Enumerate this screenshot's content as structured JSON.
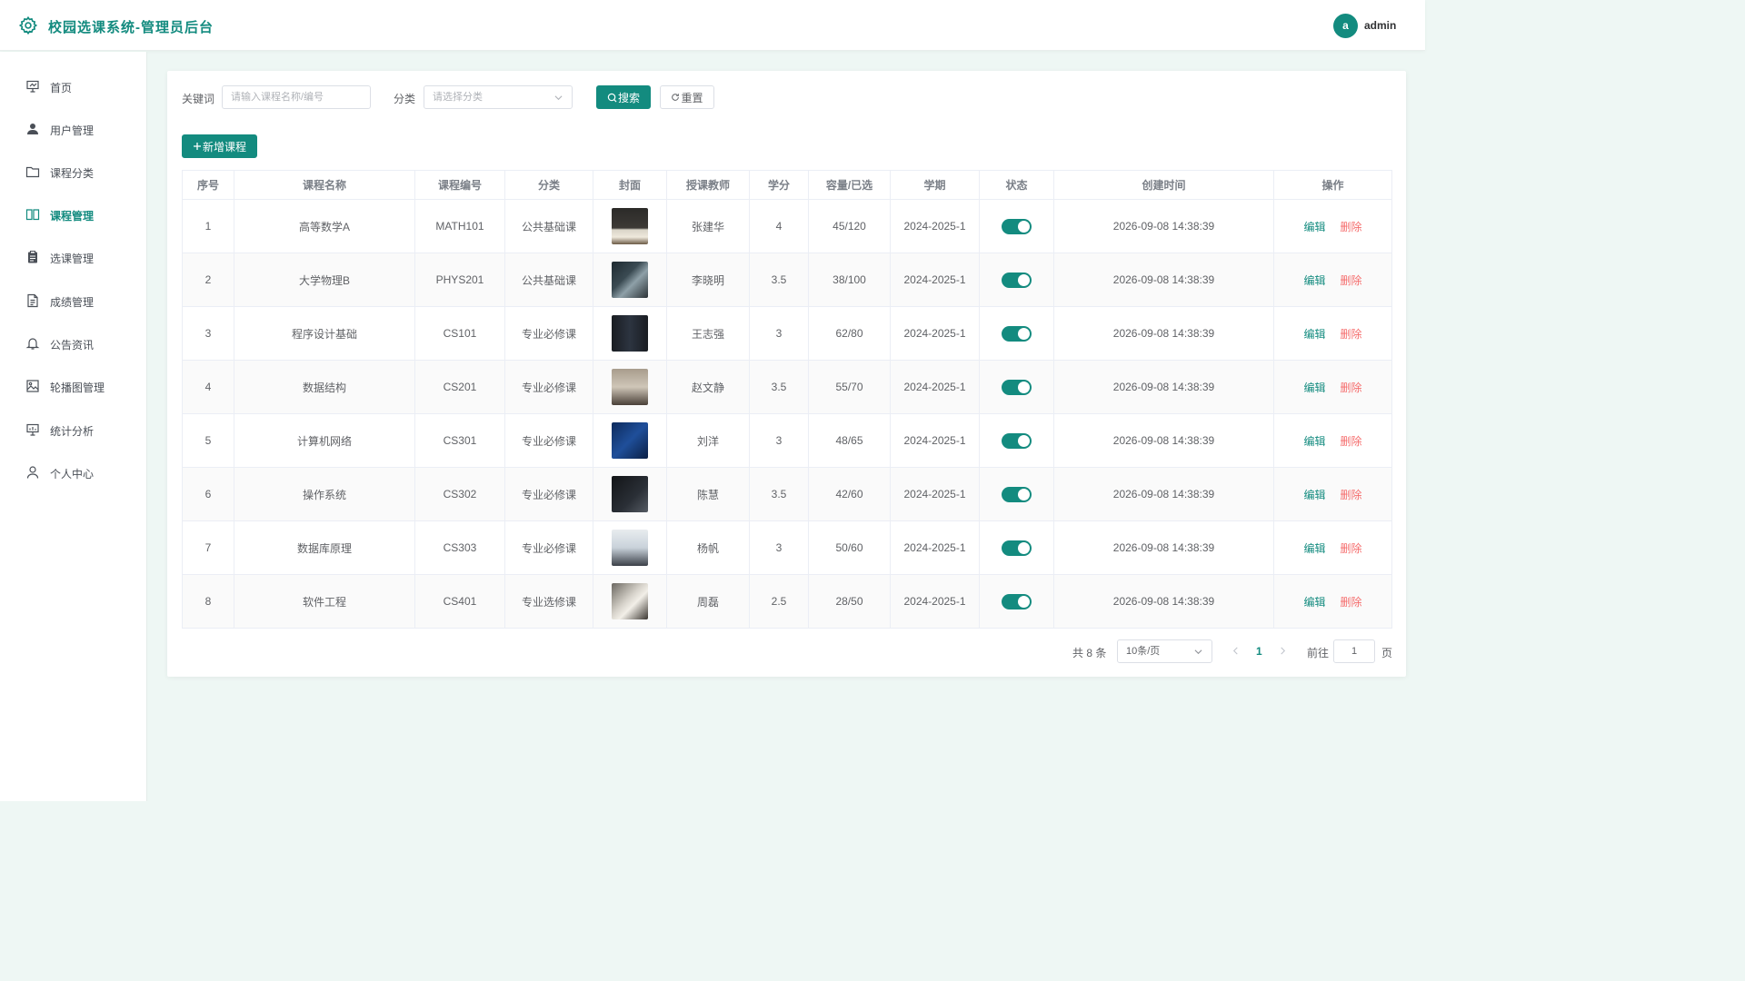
{
  "header": {
    "title": "校园选课系统-管理员后台",
    "user_initial": "a",
    "username": "admin"
  },
  "sidebar": {
    "items": [
      {
        "label": "首页",
        "icon": "presentation-icon"
      },
      {
        "label": "用户管理",
        "icon": "user-icon"
      },
      {
        "label": "课程分类",
        "icon": "folder-icon"
      },
      {
        "label": "课程管理",
        "icon": "book-icon",
        "active": true
      },
      {
        "label": "选课管理",
        "icon": "clipboard-icon"
      },
      {
        "label": "成绩管理",
        "icon": "document-icon"
      },
      {
        "label": "公告资讯",
        "icon": "bell-icon"
      },
      {
        "label": "轮播图管理",
        "icon": "image-icon"
      },
      {
        "label": "统计分析",
        "icon": "chart-icon"
      },
      {
        "label": "个人中心",
        "icon": "user-outline-icon"
      }
    ]
  },
  "filters": {
    "keyword_label": "关键词",
    "keyword_placeholder": "请输入课程名称/编号",
    "category_label": "分类",
    "category_placeholder": "请选择分类",
    "search_label": "搜索",
    "reset_label": "重置",
    "add_label": "新增课程"
  },
  "table": {
    "columns": [
      "序号",
      "课程名称",
      "课程编号",
      "分类",
      "封面",
      "授课教师",
      "学分",
      "容量/已选",
      "学期",
      "状态",
      "创建时间",
      "操作"
    ],
    "rows": [
      {
        "no": "1",
        "name": "高等数学A",
        "code": "MATH101",
        "category": "公共基础课",
        "teacher": "张建华",
        "credit": "4",
        "capacity": "45/120",
        "term": "2024-2025-1",
        "enabled": true,
        "created": "2026-09-08 14:38:39"
      },
      {
        "no": "2",
        "name": "大学物理B",
        "code": "PHYS201",
        "category": "公共基础课",
        "teacher": "李晓明",
        "credit": "3.5",
        "capacity": "38/100",
        "term": "2024-2025-1",
        "enabled": true,
        "created": "2026-09-08 14:38:39"
      },
      {
        "no": "3",
        "name": "程序设计基础",
        "code": "CS101",
        "category": "专业必修课",
        "teacher": "王志强",
        "credit": "3",
        "capacity": "62/80",
        "term": "2024-2025-1",
        "enabled": true,
        "created": "2026-09-08 14:38:39"
      },
      {
        "no": "4",
        "name": "数据结构",
        "code": "CS201",
        "category": "专业必修课",
        "teacher": "赵文静",
        "credit": "3.5",
        "capacity": "55/70",
        "term": "2024-2025-1",
        "enabled": true,
        "created": "2026-09-08 14:38:39"
      },
      {
        "no": "5",
        "name": "计算机网络",
        "code": "CS301",
        "category": "专业必修课",
        "teacher": "刘洋",
        "credit": "3",
        "capacity": "48/65",
        "term": "2024-2025-1",
        "enabled": true,
        "created": "2026-09-08 14:38:39"
      },
      {
        "no": "6",
        "name": "操作系统",
        "code": "CS302",
        "category": "专业必修课",
        "teacher": "陈慧",
        "credit": "3.5",
        "capacity": "42/60",
        "term": "2024-2025-1",
        "enabled": true,
        "created": "2026-09-08 14:38:39"
      },
      {
        "no": "7",
        "name": "数据库原理",
        "code": "CS303",
        "category": "专业必修课",
        "teacher": "杨帆",
        "credit": "3",
        "capacity": "50/60",
        "term": "2024-2025-1",
        "enabled": true,
        "created": "2026-09-08 14:38:39"
      },
      {
        "no": "8",
        "name": "软件工程",
        "code": "CS401",
        "category": "专业选修课",
        "teacher": "周磊",
        "credit": "2.5",
        "capacity": "28/50",
        "term": "2024-2025-1",
        "enabled": true,
        "created": "2026-09-08 14:38:39"
      }
    ],
    "edit_label": "编辑",
    "delete_label": "删除"
  },
  "pagination": {
    "total_text": "共 8 条",
    "page_size": "10条/页",
    "current_page": "1",
    "goto_label": "前往",
    "goto_value": "1",
    "page_suffix": "页"
  },
  "colors": {
    "accent": "#138b7f",
    "danger": "#f56c6c",
    "background": "#eef7f4"
  }
}
